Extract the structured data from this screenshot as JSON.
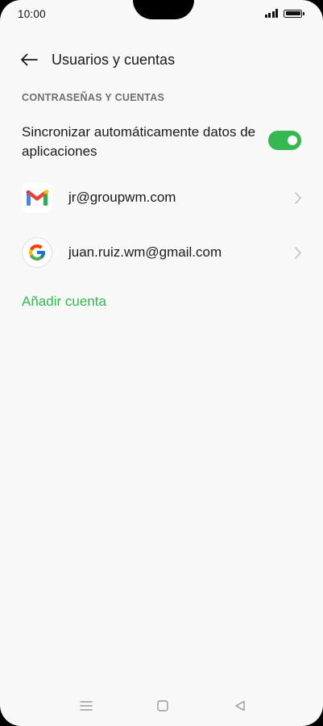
{
  "status_bar": {
    "time": "10:00"
  },
  "header": {
    "title": "Usuarios y cuentas"
  },
  "section": {
    "title": "CONTRASEÑAS Y CUENTAS"
  },
  "sync": {
    "label": "Sincronizar automáticamente datos de aplicaciones",
    "enabled": true
  },
  "accounts": [
    {
      "email": "jr@groupwm.com",
      "icon": "gmail-icon"
    },
    {
      "email": "juan.ruiz.wm@gmail.com",
      "icon": "google-icon"
    }
  ],
  "add_account": {
    "label": "Añadir cuenta"
  },
  "colors": {
    "accent": "#34b84f",
    "background": "#f8f8f8",
    "text": "#1a1a1a",
    "section_text": "#6e6e6e"
  }
}
